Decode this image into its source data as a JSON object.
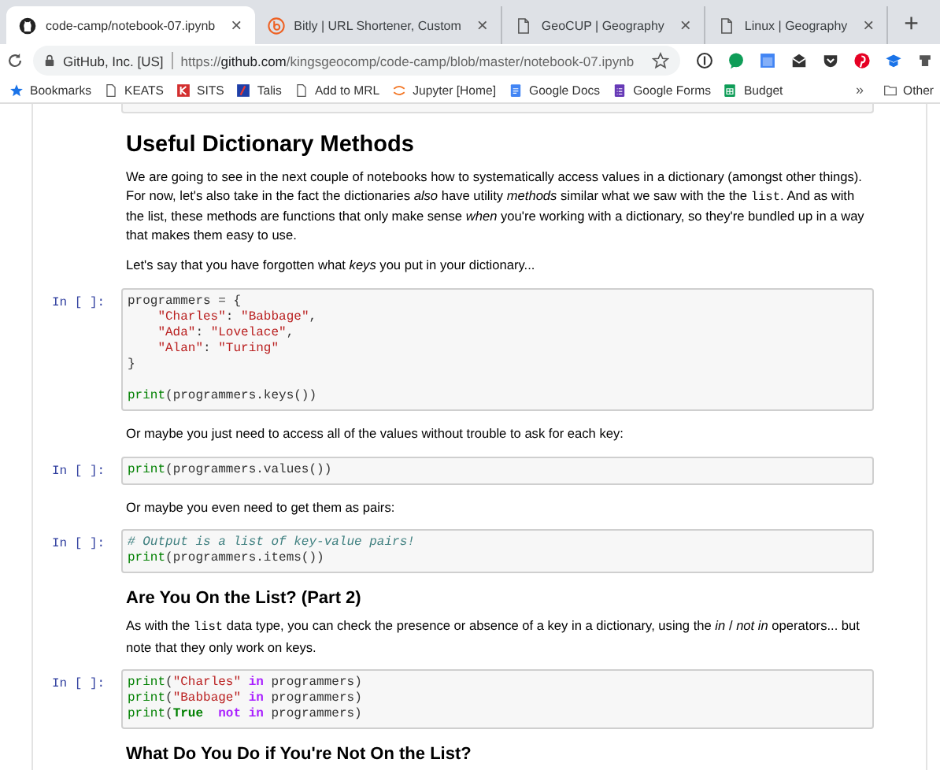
{
  "browser": {
    "tabs": [
      {
        "title": "code-camp/notebook-07.ipynb",
        "selected": true,
        "close": "×"
      },
      {
        "title": "Bitly | URL Shortener, Custom",
        "selected": false,
        "close": "×"
      },
      {
        "title": "GeoCUP | Geography",
        "selected": false,
        "close": "×"
      },
      {
        "title": "Linux | Geography",
        "selected": false,
        "close": "×"
      }
    ],
    "new_tab": "+",
    "site_identity": "GitHub, Inc. [US]",
    "url_parts": [
      "https://",
      "github.com",
      "/kingsgeocomp/code-camp/blob/master/notebook-07.ipynb"
    ],
    "bookmarks": [
      {
        "label": "Bookmarks"
      },
      {
        "label": "KEATS"
      },
      {
        "label": "SITS"
      },
      {
        "label": "Talis"
      },
      {
        "label": "Add to MRL"
      },
      {
        "label": "Jupyter [Home]"
      },
      {
        "label": "Google Docs"
      },
      {
        "label": "Google Forms"
      },
      {
        "label": "Budget"
      }
    ],
    "more": "»",
    "other_bookmarks": "Other"
  },
  "notebook": {
    "cells": [
      {
        "kind": "h2",
        "text": "Useful Dictionary Methods"
      },
      {
        "kind": "paragraph",
        "parts": [
          {
            "kind": "text",
            "text": "We are going to see in the next couple of notebooks how to systematically access values in a dictionary (amongst other things). For now, let's also take in the fact the dictionaries *also* have utility *methods* similar what we saw with the the "
          },
          {
            "kind": "code",
            "text": "list"
          },
          {
            "kind": "text",
            "text": ". And as with the list, these methods are functions that only make sense *when* you're working with a dictionary, so they're bundled up in a way that makes them easy to use."
          }
        ]
      },
      {
        "kind": "paragraph",
        "parts": [
          {
            "kind": "text",
            "text": "Let's say that you have forgotten what *keys* you put in your dictionary..."
          }
        ]
      },
      {
        "kind": "code",
        "prompt": "In [ ]:",
        "lines": [
          {
            "kind": "code",
            "tokens": [
              {
                "kind": "plain",
                "text": "programmers = {"
              }
            ]
          },
          {
            "kind": "code",
            "tokens": [
              {
                "kind": "string",
                "text": "    \"Charles\""
              },
              {
                "kind": "plain",
                "text": ": "
              },
              {
                "kind": "string",
                "text": "\"Babbage\""
              },
              {
                "kind": "plain",
                "text": ","
              }
            ]
          },
          {
            "kind": "code",
            "tokens": [
              {
                "kind": "string",
                "text": "    \"Ada\""
              },
              {
                "kind": "plain",
                "text": ": "
              },
              {
                "kind": "string",
                "text": "\"Lovelace\""
              },
              {
                "kind": "plain",
                "text": ","
              }
            ]
          },
          {
            "kind": "code",
            "tokens": [
              {
                "kind": "string",
                "text": "    \"Alan\""
              },
              {
                "kind": "plain",
                "text": ": "
              },
              {
                "kind": "string",
                "text": "\"Turing\""
              }
            ]
          },
          {
            "kind": "code",
            "tokens": [
              {
                "kind": "plain",
                "text": "}"
              }
            ]
          },
          {
            "kind": "blank"
          },
          {
            "kind": "code",
            "tokens": [
              {
                "kind": "builtin",
                "text": "print"
              },
              {
                "kind": "plain",
                "text": "(programmers.keys())"
              }
            ]
          }
        ]
      },
      {
        "kind": "paragraph",
        "parts": [
          {
            "kind": "text",
            "text": "Or maybe you just need to access all of the values without trouble to ask for each key:"
          }
        ]
      },
      {
        "kind": "code",
        "prompt": "In [ ]:",
        "lines": [
          {
            "kind": "code",
            "tokens": [
              {
                "kind": "builtin",
                "text": "print"
              },
              {
                "kind": "plain",
                "text": "(programmers.values())"
              }
            ]
          }
        ]
      },
      {
        "kind": "paragraph",
        "parts": [
          {
            "kind": "text",
            "text": "Or maybe you even need to get them as pairs:"
          }
        ]
      },
      {
        "kind": "code",
        "prompt": "In [ ]:",
        "lines": [
          {
            "kind": "code",
            "tokens": [
              {
                "kind": "comment",
                "text": "# Output is a list of key-value pairs!"
              }
            ]
          },
          {
            "kind": "code",
            "tokens": [
              {
                "kind": "builtin",
                "text": "print"
              },
              {
                "kind": "plain",
                "text": "(programmers.items())"
              }
            ]
          }
        ]
      },
      {
        "kind": "h3",
        "text": "Are You On the List? (Part 2)"
      },
      {
        "kind": "paragraph",
        "parts": [
          {
            "kind": "text",
            "text": "As with the "
          },
          {
            "kind": "code",
            "text": "list"
          },
          {
            "kind": "text",
            "text": " data type, you can check the presence or absence of a key in a dictionary, using the *in* / *not in* operators... but note that they only work on keys."
          }
        ]
      },
      {
        "kind": "code",
        "prompt": "In [ ]:",
        "lines": [
          {
            "kind": "code",
            "tokens": [
              {
                "kind": "builtin",
                "text": "print"
              },
              {
                "kind": "plain",
                "text": "("
              },
              {
                "kind": "string",
                "text": "\"Charles\""
              },
              {
                "kind": "keyword",
                "text": " in"
              },
              {
                "kind": "plain",
                "text": " programmers)"
              }
            ]
          },
          {
            "kind": "code",
            "tokens": [
              {
                "kind": "builtin",
                "text": "print"
              },
              {
                "kind": "plain",
                "text": "("
              },
              {
                "kind": "string",
                "text": "\"Babbage\""
              },
              {
                "kind": "keyword",
                "text": " in"
              },
              {
                "kind": "plain",
                "text": " programmers)"
              }
            ]
          },
          {
            "kind": "code",
            "tokens": [
              {
                "kind": "builtin",
                "text": "print"
              },
              {
                "kind": "plain",
                "text": "("
              },
              {
                "kind": "constant",
                "text": "True"
              },
              {
                "kind": "keyword",
                "text": "  not in"
              },
              {
                "kind": "plain",
                "text": " programmers)"
              }
            ]
          }
        ]
      },
      {
        "kind": "h3",
        "text": "What Do You Do if You're Not On the List?"
      }
    ]
  }
}
